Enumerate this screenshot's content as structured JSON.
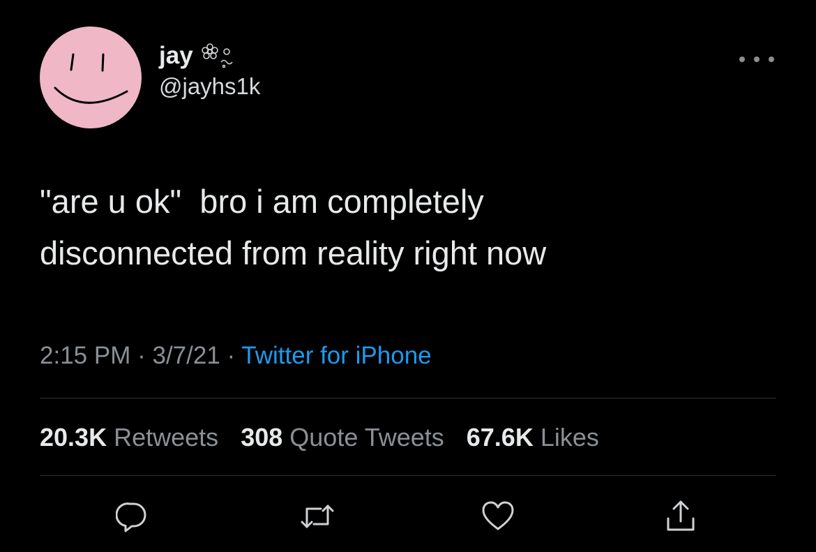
{
  "author": {
    "display_name": "jay",
    "handle": "@jayhs1k",
    "avatar_icon": "smiley-face-icon",
    "avatar_color": "#f0b7c6",
    "name_decoration_icon": "flower-doodle-icon"
  },
  "tweet": {
    "text": "\"are u ok\"  bro i am completely\ndisconnected from reality right now",
    "time": "2:15 PM",
    "separator": "·",
    "date": "3/7/21",
    "source": "Twitter for iPhone"
  },
  "stats": {
    "retweets_count": "20.3K",
    "retweets_label": "Retweets",
    "quote_count": "308",
    "quote_label": "Quote Tweets",
    "likes_count": "67.6K",
    "likes_label": "Likes"
  },
  "actions": {
    "reply_icon": "reply-icon",
    "retweet_icon": "retweet-icon",
    "like_icon": "heart-icon",
    "share_icon": "share-icon",
    "more_icon": "more-options-icon"
  },
  "colors": {
    "background": "#000000",
    "text": "#e7e9ea",
    "secondary_text": "#8b9095",
    "link": "#1d9bf0",
    "divider": "#2f3336"
  }
}
